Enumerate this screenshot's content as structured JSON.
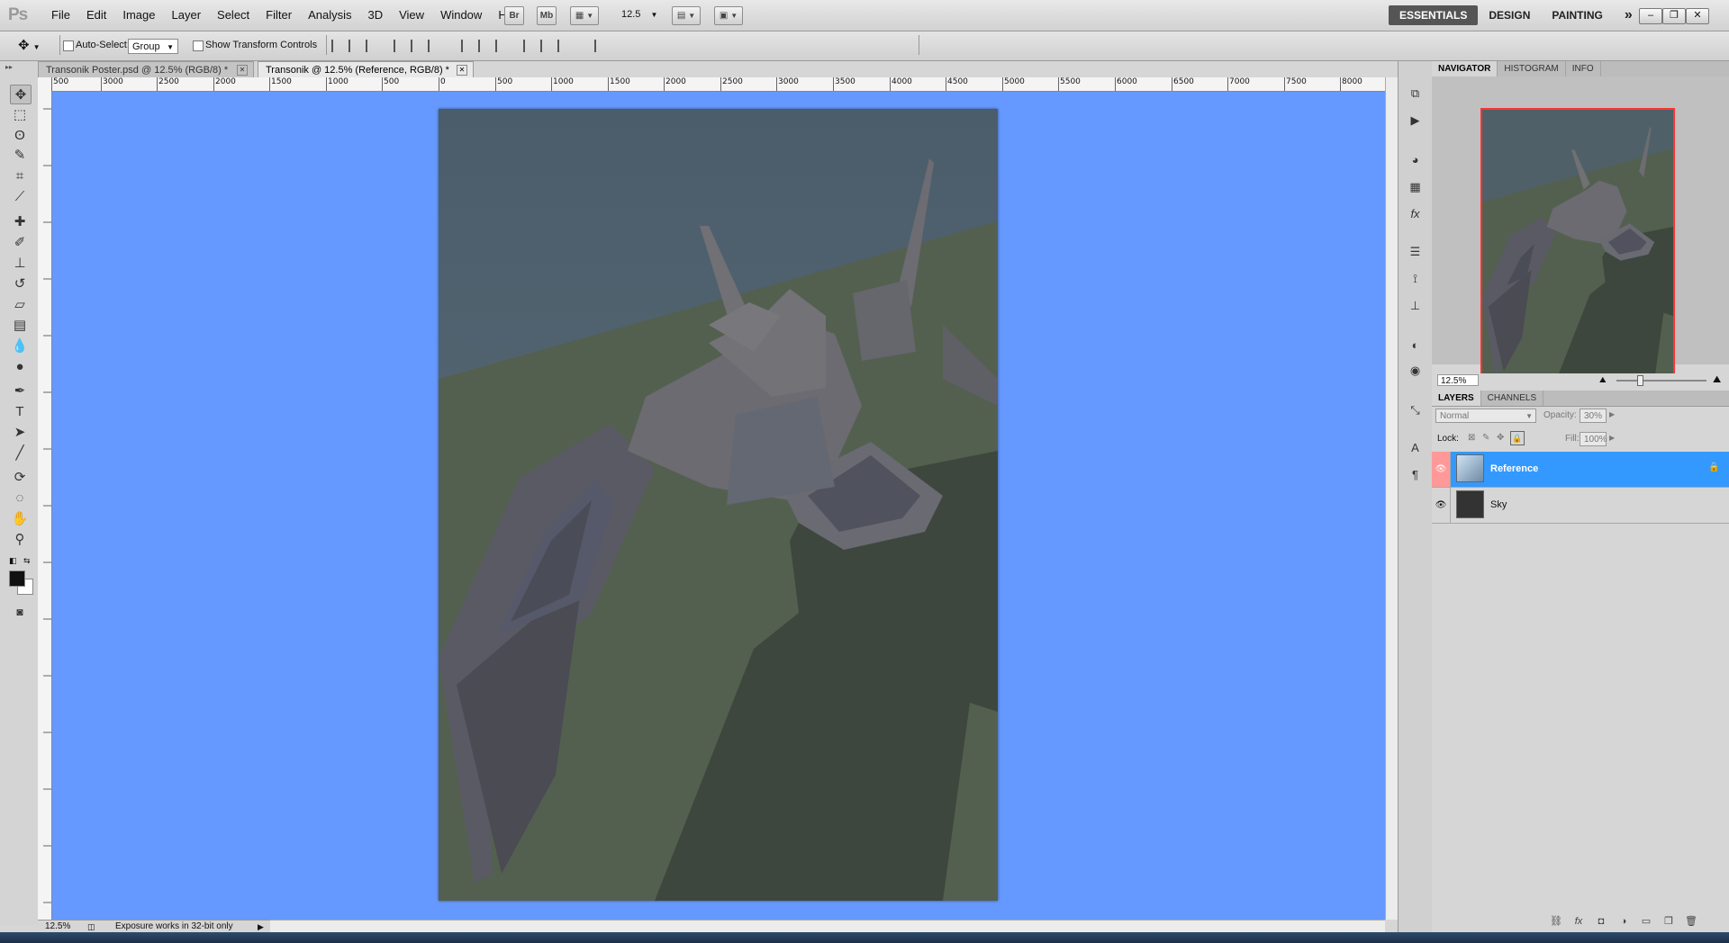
{
  "app": {
    "logo": "Ps",
    "menus": [
      "File",
      "Edit",
      "Image",
      "Layer",
      "Select",
      "Filter",
      "Analysis",
      "3D",
      "View",
      "Window",
      "Help"
    ],
    "app_buttons": {
      "bridge": "Br",
      "minibridge": "Mb",
      "zoom_value": "12.5"
    },
    "workspaces": [
      "ESSENTIALS",
      "DESIGN",
      "PAINTING"
    ],
    "workspace_more": "»",
    "window_controls": {
      "minimize": "–",
      "restore": "❐",
      "close": "✕"
    }
  },
  "options": {
    "auto_select_label": "Auto-Select:",
    "auto_select_value": "Group",
    "show_transform_label": "Show Transform Controls"
  },
  "tabs": [
    {
      "label": "Transonik Poster.psd @ 12.5% (RGB/8) *",
      "close": "✕"
    },
    {
      "label": "Transonik @ 12.5% (Reference, RGB/8) *",
      "close": "✕"
    }
  ],
  "ruler_top": [
    "500",
    "3000",
    "2500",
    "2000",
    "1500",
    "1000",
    "500",
    "0",
    "500",
    "1000",
    "1500",
    "2000",
    "2500",
    "3000",
    "3500",
    "4000",
    "4500",
    "5000",
    "5500",
    "6000",
    "6500",
    "7000",
    "7500",
    "8000"
  ],
  "status": {
    "zoom": "12.5%",
    "message": "Exposure works in 32-bit only"
  },
  "panels": {
    "nav_tabs": [
      "NAVIGATOR",
      "HISTOGRAM",
      "INFO"
    ],
    "nav_zoom": "12.5%",
    "layer_tabs": [
      "LAYERS",
      "CHANNELS"
    ],
    "blend_mode": "Normal",
    "opacity_label": "Opacity:",
    "opacity_value": "30%",
    "lock_label": "Lock:",
    "fill_label": "Fill:",
    "fill_value": "100%",
    "layers": [
      {
        "name": "Reference",
        "selected": true,
        "locked": true
      },
      {
        "name": "Sky",
        "selected": false,
        "locked": false
      }
    ]
  },
  "colors": {
    "pasteboard": "#6699ff",
    "selection": "#3399ff",
    "nav_frame": "#ff3333"
  }
}
